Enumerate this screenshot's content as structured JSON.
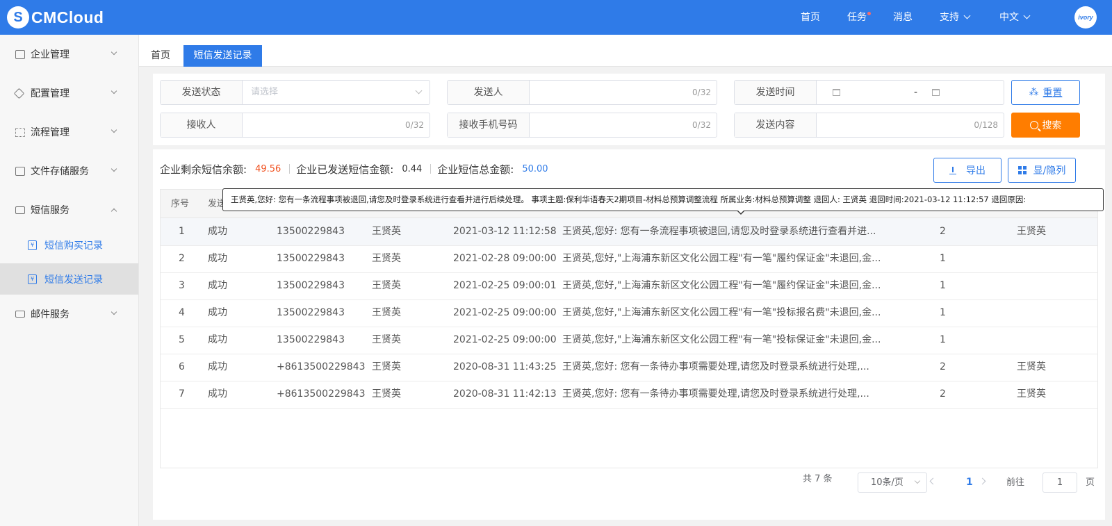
{
  "brand": {
    "logo_mark": "S",
    "name": "CMCloud",
    "avatar_text": "ivory"
  },
  "topnav": {
    "home": "首页",
    "tasks": "任务",
    "messages": "消息",
    "support": "支持",
    "language": "中文"
  },
  "sidebar": {
    "items": [
      {
        "label": "企业管理",
        "icon": "building-icon"
      },
      {
        "label": "配置管理",
        "icon": "layers-icon"
      },
      {
        "label": "流程管理",
        "icon": "flow-icon"
      },
      {
        "label": "文件存储服务",
        "icon": "download-box-icon"
      },
      {
        "label": "短信服务",
        "icon": "mail-icon"
      },
      {
        "label": "邮件服务",
        "icon": "id-card-icon"
      }
    ],
    "sub_items": [
      {
        "label": "短信购买记录",
        "icon": "yen-receipt-icon"
      },
      {
        "label": "短信发送记录",
        "icon": "yen-search-icon"
      }
    ]
  },
  "tabs": {
    "home": "首页",
    "active": "短信发送记录"
  },
  "filters": {
    "send_status": {
      "label": "发送状态",
      "placeholder": "请选择"
    },
    "sender": {
      "label": "发送人",
      "count": "0/32"
    },
    "send_time": {
      "label": "发送时间",
      "separator": "-"
    },
    "receiver": {
      "label": "接收人",
      "count": "0/32"
    },
    "receiver_phone": {
      "label": "接收手机号码",
      "count": "0/32"
    },
    "content": {
      "label": "发送内容",
      "count": "0/128"
    },
    "reset_label": "重置",
    "search_label": "搜索"
  },
  "stats": {
    "balance_label": "企业剩余短信余额:",
    "balance_value": "49.56",
    "sent_label": "企业已发送短信金额:",
    "sent_value": "0.44",
    "total_label": "企业短信总金额:",
    "total_value": "50.00"
  },
  "actions": {
    "export": "导出",
    "columns": "显/隐列"
  },
  "table": {
    "headers": [
      "序号",
      "发送"
    ],
    "rows": [
      {
        "no": "1",
        "status": "成功",
        "phone": "13500229843",
        "receiver": "王贤英",
        "time": "2021-03-12 11:12:58",
        "content": "王贤英,您好: 您有一条流程事项被退回,请您及时登录系统进行查看并进...",
        "count": "2",
        "sender": "王贤英"
      },
      {
        "no": "2",
        "status": "成功",
        "phone": "13500229843",
        "receiver": "王贤英",
        "time": "2021-02-28 09:00:00",
        "content": "王贤英,您好,\"上海浦东新区文化公园工程\"有一笔\"履约保证金\"未退回,金...",
        "count": "1",
        "sender": ""
      },
      {
        "no": "3",
        "status": "成功",
        "phone": "13500229843",
        "receiver": "王贤英",
        "time": "2021-02-25 09:00:01",
        "content": "王贤英,您好,\"上海浦东新区文化公园工程\"有一笔\"履约保证金\"未退回,金...",
        "count": "1",
        "sender": ""
      },
      {
        "no": "4",
        "status": "成功",
        "phone": "13500229843",
        "receiver": "王贤英",
        "time": "2021-02-25 09:00:00",
        "content": "王贤英,您好,\"上海浦东新区文化公园工程\"有一笔\"投标报名费\"未退回,金...",
        "count": "1",
        "sender": ""
      },
      {
        "no": "5",
        "status": "成功",
        "phone": "13500229843",
        "receiver": "王贤英",
        "time": "2021-02-25 09:00:00",
        "content": "王贤英,您好,\"上海浦东新区文化公园工程\"有一笔\"投标保证金\"未退回,金...",
        "count": "1",
        "sender": ""
      },
      {
        "no": "6",
        "status": "成功",
        "phone": "+8613500229843",
        "receiver": "王贤英",
        "time": "2020-08-31 11:43:25",
        "content": "王贤英,您好: 您有一条待办事项需要处理,请您及时登录系统进行处理,...",
        "count": "2",
        "sender": "王贤英"
      },
      {
        "no": "7",
        "status": "成功",
        "phone": "+8613500229843",
        "receiver": "王贤英",
        "time": "2020-08-31 11:42:13",
        "content": "王贤英,您好: 您有一条待办事项需要处理,请您及时登录系统进行处理,...",
        "count": "2",
        "sender": "王贤英"
      }
    ]
  },
  "tooltip": "王贤英,您好: 您有一条流程事项被退回,请您及时登录系统进行查看并进行后续处理。 事项主题:保利华语春天2期项目-材料总预算调整流程 所属业务:材料总预算调整 退回人: 王贤英 退回时间:2021-03-12 11:12:57 退回原因:",
  "pagination": {
    "total": "共 7 条",
    "page_size": "10条/页",
    "current": "1",
    "goto_label": "前往",
    "goto_value": "1",
    "page_suffix": "页"
  },
  "colors": {
    "primary": "#2f7be8",
    "orange": "#ff7d00",
    "balance_red": "#f0511f",
    "total_blue": "#2f7be8"
  }
}
